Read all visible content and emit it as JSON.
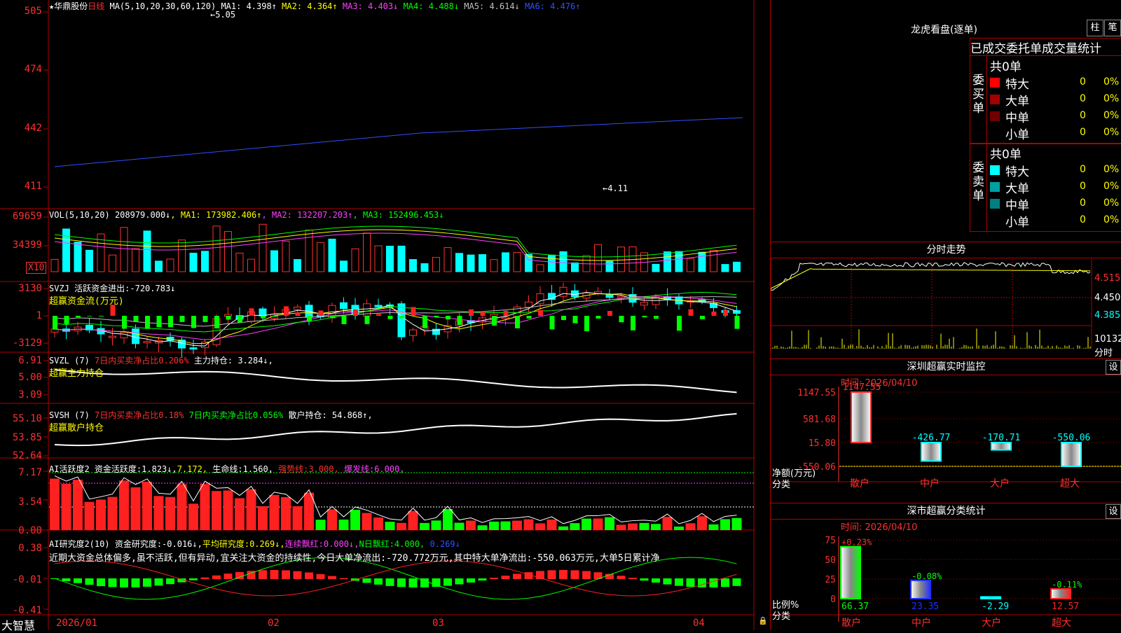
{
  "app_logo": "大智慧",
  "date_axis": [
    "2026/01",
    "02",
    "03",
    "04"
  ],
  "colors": {
    "up": "#ff3030",
    "down": "#00ffff",
    "grid": "#b00000"
  },
  "main": {
    "title": "★华鼎股份",
    "period": "日线",
    "ma_label": "MA(5,10,20,30,60,120)",
    "ma": [
      {
        "name": "MA1:",
        "val": "4.398↑",
        "color": "#ffffff"
      },
      {
        "name": "MA2:",
        "val": "4.364↑",
        "color": "#ffff00"
      },
      {
        "name": "MA3:",
        "val": "4.403↓",
        "color": "#ff40ff"
      },
      {
        "name": "MA4:",
        "val": "4.488↓",
        "color": "#00ff00"
      },
      {
        "name": "MA5:",
        "val": "4.614↓",
        "color": "#c0c0c0"
      },
      {
        "name": "MA6:",
        "val": "4.476↑",
        "color": "#3050ff"
      }
    ],
    "yticks": [
      "505",
      "474",
      "442",
      "411"
    ],
    "high_label": "5.05",
    "low_label": "4.11"
  },
  "vol": {
    "label": "VOL(5,10,20)",
    "val": "208979.000↓",
    "ma": [
      {
        "name": "MA1:",
        "val": "173982.406↑",
        "color": "#ffff00"
      },
      {
        "name": "MA2:",
        "val": "132207.203↑",
        "color": "#ff40ff"
      },
      {
        "name": "MA3:",
        "val": "152496.453↓",
        "color": "#00ff00"
      }
    ],
    "yticks": [
      "69659",
      "34399"
    ],
    "unit": "X10"
  },
  "svzj": {
    "label": "SVZJ",
    "desc": "活跃资金进出:",
    "val": "-720.783↓",
    "sub": "超赢资金流(万元)",
    "yticks": [
      "3130",
      "1",
      "-3129"
    ]
  },
  "svzl": {
    "label": "SVZL (7)",
    "p1": "7日内买卖净占比0.206%",
    "p2": "主力持仓:",
    "val": "3.284↓,",
    "sub": "超赢主力持仓",
    "yticks": [
      "6.91",
      "5.00",
      "3.09"
    ]
  },
  "svsh": {
    "label": "SVSH (7)",
    "p1": "7日内买卖净占比0.18%",
    "p2": "7日内买卖净占比0.056%",
    "p3": "散户持仓:",
    "val": "54.868↑,",
    "sub": "超赢散户持仓",
    "yticks": [
      "55.10",
      "53.85",
      "52.64"
    ]
  },
  "ai1": {
    "label": "AI活跃度2",
    "a": "资金活跃度:",
    "av": "1.823↓,",
    "b": "7.172,",
    "c": "生命线:",
    "cv": "1.560,",
    "d": "强势线:",
    "dv": "3.000,",
    "e": "爆发线:",
    "ev": "6.000,",
    "yticks": [
      "7.17",
      "3.54",
      "0.00"
    ]
  },
  "ai2": {
    "label": "AI研究度2(10)",
    "a": "资金研究度:",
    "av": "-0.016↓,",
    "b": "平均研究度:",
    "bv": "0.269↓,",
    "c": "连续飘红:",
    "cv": "0.000↓,",
    "d": "N日飘红:",
    "dv": "4.000,",
    "e": "0.269↓",
    "text": "近期大资金总体偏多,虽不活跃,但有异动,宜关注大资金的持续性,今日大单净流出:-720.772万元,其中特大单净流出:-550.063万元,大单5日累计净",
    "yticks": [
      "0.38",
      "-0.01",
      "-0.41"
    ]
  },
  "lhb": {
    "title": "龙虎看盘(逐单)",
    "btn1": "柱",
    "btn2": "笔",
    "tab1": "已成交",
    "tab2": "委托单",
    "tab3": "成交量统计",
    "buy": {
      "side": "委买单",
      "count": "共0单",
      "rows": [
        {
          "k": "特大",
          "v": "0",
          "p": "0%",
          "color": "#ff0000"
        },
        {
          "k": "大单",
          "v": "0",
          "p": "0%",
          "color": "#a00000"
        },
        {
          "k": "中单",
          "v": "0",
          "p": "0%",
          "color": "#700000"
        },
        {
          "k": "小单",
          "v": "0",
          "p": "0%",
          "color": "#000000"
        }
      ]
    },
    "sell": {
      "side": "委卖单",
      "count": "共0单",
      "rows": [
        {
          "k": "特大",
          "v": "0",
          "p": "0%",
          "color": "#00ffff"
        },
        {
          "k": "大单",
          "v": "0",
          "p": "0%",
          "color": "#00a0a0"
        },
        {
          "k": "中单",
          "v": "0",
          "p": "0%",
          "color": "#008080"
        },
        {
          "k": "小单",
          "v": "0",
          "p": "0%",
          "color": "#000000"
        }
      ]
    }
  },
  "fs": {
    "title": "分时走势",
    "yticks": [
      "4.515",
      "4.450",
      "4.385"
    ],
    "vol": "10132",
    "unit": "分时"
  },
  "szmon": {
    "title": "深圳超赢实时监控",
    "btn": "设",
    "time": "时间: 2026/04/10",
    "yticks": [
      "1147.55",
      "581.68",
      "15.80",
      "-550.06"
    ],
    "ylab": "净额(万元)",
    "xlab": "分类",
    "bars": [
      {
        "cat": "散户",
        "val": "1147.55"
      },
      {
        "cat": "中户",
        "val": "-426.77"
      },
      {
        "cat": "大户",
        "val": "-170.71"
      },
      {
        "cat": "超大",
        "val": "-550.06"
      }
    ]
  },
  "szstat": {
    "title": "深市超赢分类统计",
    "btn": "设",
    "time": "时间: 2026/04/10",
    "yticks": [
      "75",
      "50",
      "25",
      "0"
    ],
    "ylab": "比例%",
    "xlab": "分类",
    "bars": [
      {
        "cat": "散户",
        "top": "+0.23%",
        "bot": "66.37",
        "color": "#00ff00"
      },
      {
        "cat": "中户",
        "top": "-0.08%",
        "bot": "23.35",
        "color": "#2030ff"
      },
      {
        "cat": "大户",
        "top": "",
        "bot": "-2.29",
        "color": "#00ffff"
      },
      {
        "cat": "超大",
        "top": "-0.11%",
        "bot": "12.57",
        "color": "#ff2020"
      }
    ]
  }
}
